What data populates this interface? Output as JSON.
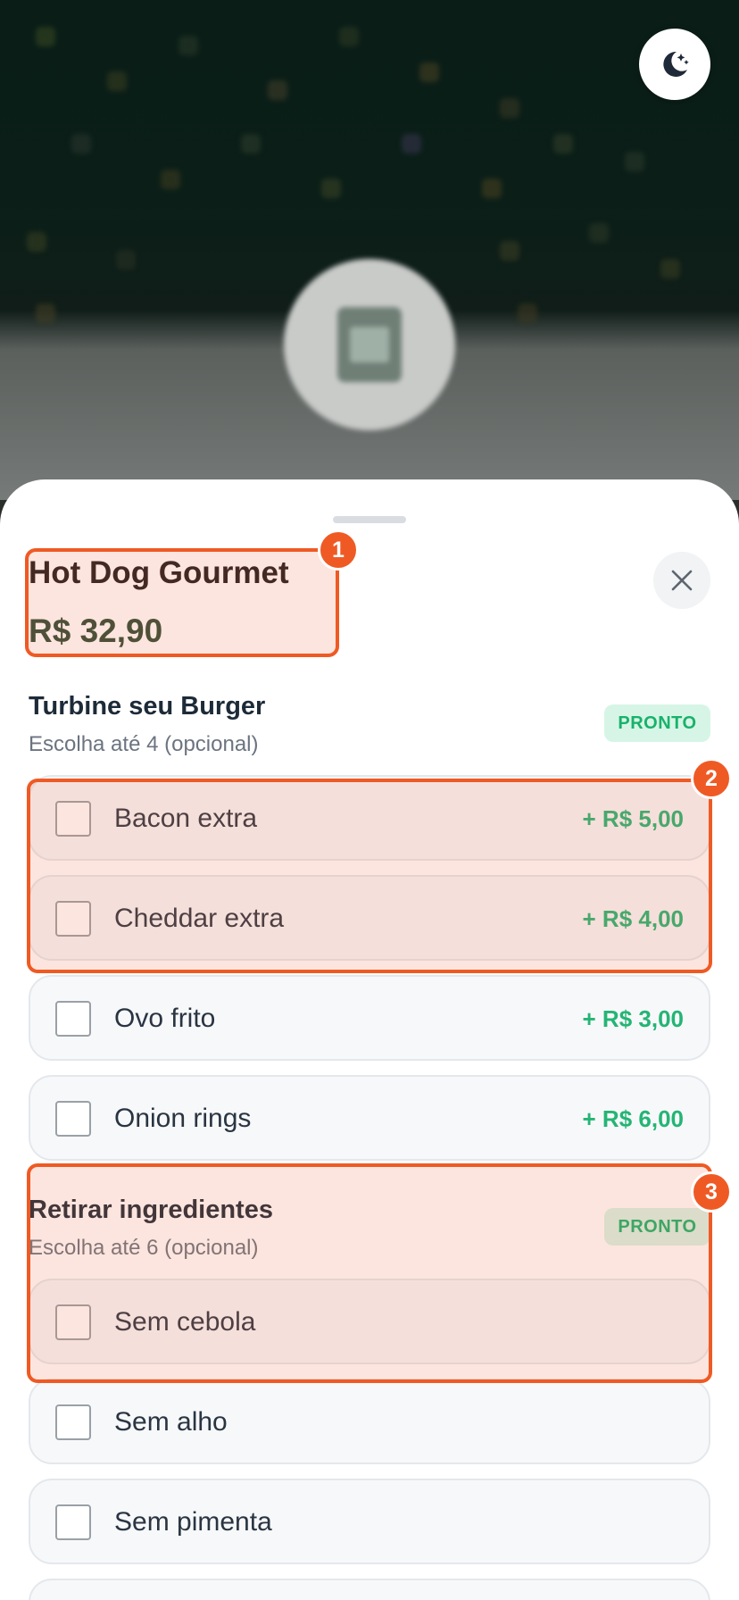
{
  "product": {
    "name": "Hot Dog Gourmet",
    "price": "R$ 32,90"
  },
  "groups": [
    {
      "title": "Turbine seu Burger",
      "subtitle": "Escolha até 4 (opcional)",
      "badge": "PRONTO",
      "options": [
        {
          "label": "Bacon extra",
          "price": "+ R$ 5,00",
          "checked": false
        },
        {
          "label": "Cheddar extra",
          "price": "+ R$ 4,00",
          "checked": false
        },
        {
          "label": "Ovo frito",
          "price": "+ R$ 3,00",
          "checked": false
        },
        {
          "label": "Onion rings",
          "price": "+ R$ 6,00",
          "checked": false
        }
      ]
    },
    {
      "title": "Retirar ingredientes",
      "subtitle": "Escolha até 6 (opcional)",
      "badge": "PRONTO",
      "options": [
        {
          "label": "Sem cebola",
          "checked": false
        },
        {
          "label": "Sem alho",
          "checked": false
        },
        {
          "label": "Sem pimenta",
          "checked": false
        }
      ]
    }
  ],
  "annotations": [
    "1",
    "2",
    "3"
  ],
  "icons": {
    "theme_toggle": "moon-stars-icon",
    "close": "close-icon"
  },
  "colors": {
    "accent_green": "#24b574",
    "price_dark_green": "#2d4a35",
    "annotation_orange": "#ef5a24",
    "badge_bg": "#d7f5e6"
  }
}
